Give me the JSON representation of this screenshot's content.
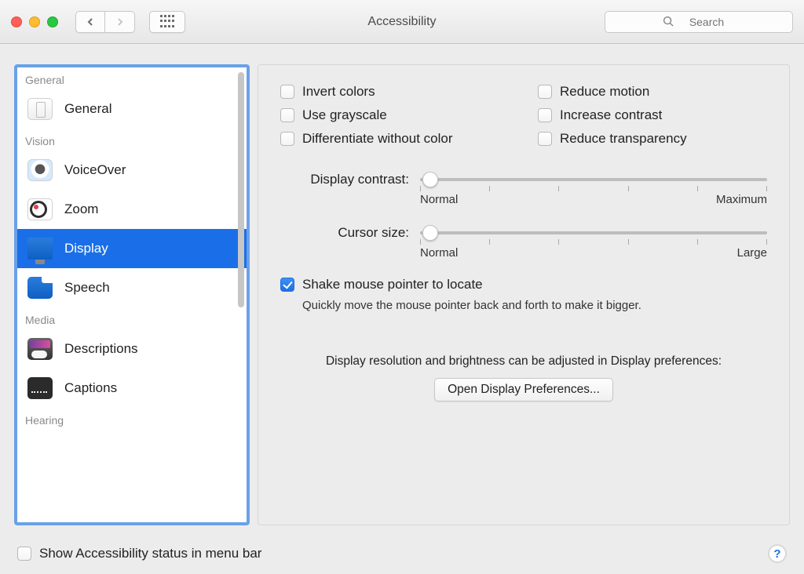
{
  "window": {
    "title": "Accessibility"
  },
  "toolbar": {
    "search_placeholder": "Search"
  },
  "sidebar": {
    "sections": [
      {
        "label": "General",
        "items": [
          {
            "label": "General"
          }
        ]
      },
      {
        "label": "Vision",
        "items": [
          {
            "label": "VoiceOver"
          },
          {
            "label": "Zoom"
          },
          {
            "label": "Display",
            "selected": true
          },
          {
            "label": "Speech"
          }
        ]
      },
      {
        "label": "Media",
        "items": [
          {
            "label": "Descriptions"
          },
          {
            "label": "Captions"
          }
        ]
      },
      {
        "label": "Hearing",
        "items": []
      }
    ]
  },
  "main": {
    "checks_left": [
      "Invert colors",
      "Use grayscale",
      "Differentiate without color"
    ],
    "checks_right": [
      "Reduce motion",
      "Increase contrast",
      "Reduce transparency"
    ],
    "contrast": {
      "label": "Display contrast:",
      "min_label": "Normal",
      "max_label": "Maximum"
    },
    "cursor": {
      "label": "Cursor size:",
      "min_label": "Normal",
      "max_label": "Large"
    },
    "shake": {
      "label": "Shake mouse pointer to locate",
      "checked": true,
      "hint": "Quickly move the mouse pointer back and forth to make it bigger."
    },
    "footer_note": "Display resolution and brightness can be adjusted in Display preferences:",
    "open_button": "Open Display Preferences..."
  },
  "bottom": {
    "menubar_label": "Show Accessibility status in menu bar"
  }
}
